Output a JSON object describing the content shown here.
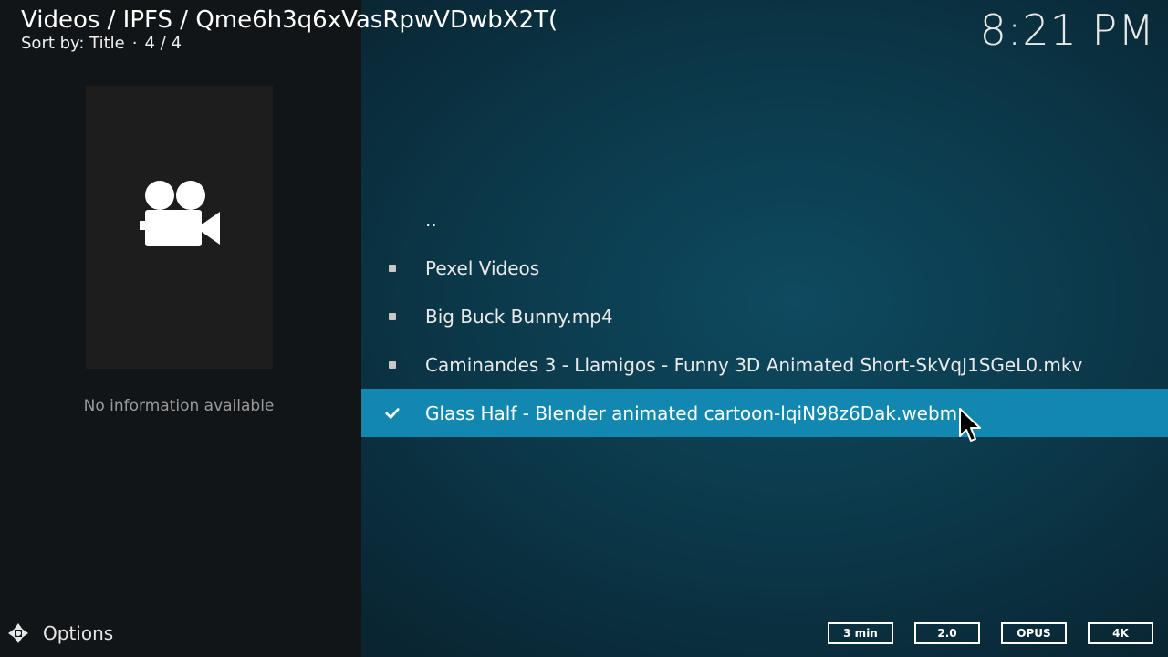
{
  "header": {
    "path": "Videos / IPFS / Qme6h3q6xVasRpwVDwbX2T(",
    "sort_label": "Sort by: Title",
    "separator": "·",
    "count": "4 / 4",
    "clock": "8:21 PM"
  },
  "info_panel": {
    "thumbnail_icon": "video-camera-icon",
    "no_info_text": "No information available"
  },
  "list": {
    "items": [
      {
        "label": "..",
        "marker": "none"
      },
      {
        "label": "Pexel Videos",
        "marker": "square"
      },
      {
        "label": "Big Buck Bunny.mp4",
        "marker": "square"
      },
      {
        "label": "Caminandes 3 - Llamigos - Funny 3D Animated Short-SkVqJ1SGeL0.mkv",
        "marker": "square"
      },
      {
        "label": "Glass Half - Blender animated cartoon-lqiN98z6Dak.webm",
        "marker": "check",
        "selected": true
      }
    ]
  },
  "footer": {
    "options_label": "Options",
    "options_icon": "options-arrows-icon",
    "badges": [
      "3 min",
      "2.0",
      "OPUS",
      "4K"
    ]
  },
  "colors": {
    "selection": "#1287b0",
    "left_panel": "#111518",
    "background": "#0b3849"
  }
}
